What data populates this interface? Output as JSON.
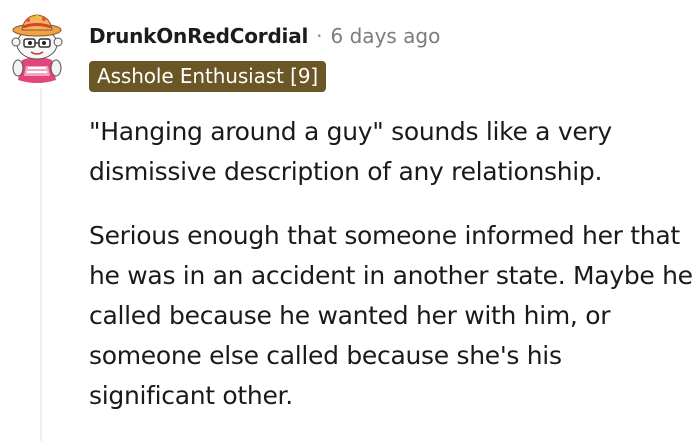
{
  "comment": {
    "username": "DrunkOnRedCordial",
    "separator": "·",
    "timestamp": "6 days ago",
    "flair": "Asshole Enthusiast [9]",
    "paragraphs": [
      "\"Hanging around a guy\" sounds like a very dismissive description of any relationship.",
      "Serious enough that someone informed her that he was in an accident in another state. Maybe he called because he wanted her with him, or someone else called because she's his significant other."
    ]
  },
  "colors": {
    "flair_background": "#6b5626",
    "username": "#1c1c1c",
    "meta": "#7c7c7c"
  },
  "icons": {
    "avatar": "snoo-avatar-icon"
  }
}
